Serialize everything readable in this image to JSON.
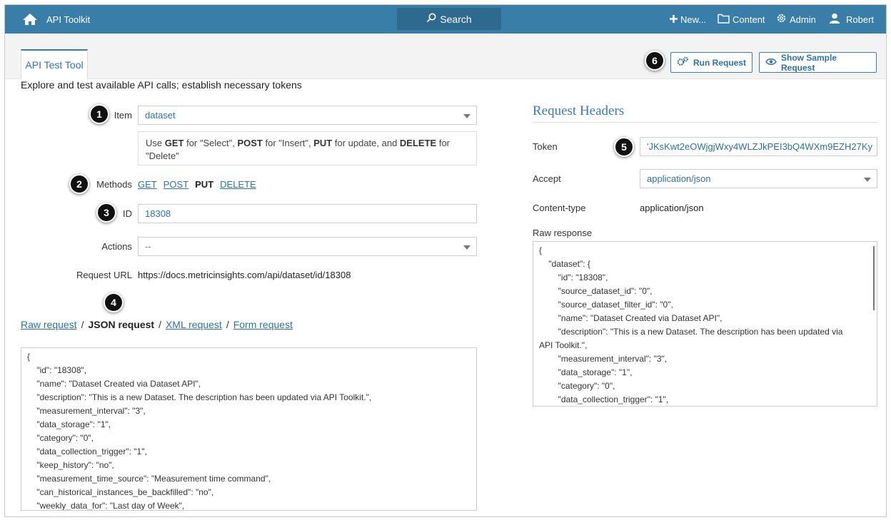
{
  "app": {
    "title": "API Toolkit"
  },
  "topnav": {
    "search_label": "Search",
    "new_label": "New...",
    "content_label": "Content",
    "admin_label": "Admin",
    "user_label": "Robert"
  },
  "tabs": [
    {
      "label": "API Test Tool",
      "active": true
    }
  ],
  "toolbar": {
    "run_label": "Run Request",
    "sample_label": "Show Sample Request"
  },
  "page": {
    "subtitle": "Explore and test available API calls; establish necessary tokens"
  },
  "form": {
    "item_label": "Item",
    "item_value": "dataset",
    "hint": {
      "p1": "Use ",
      "get": "GET",
      "p2": " for \"Select\", ",
      "post": "POST",
      "p3": " for \"Insert\", ",
      "put": "PUT",
      "p4": " for update, and ",
      "delete": "DELETE",
      "p5": " for \"Delete\""
    },
    "methods_label": "Methods",
    "methods": [
      "GET",
      "POST",
      "PUT",
      "DELETE"
    ],
    "selected_method": "PUT",
    "id_label": "ID",
    "id_value": "18308",
    "actions_label": "Actions",
    "actions_value": "--",
    "request_url_label": "Request URL",
    "request_url_value": "https://docs.metricinsights.com/api/dataset/id/18308"
  },
  "request_tabs": {
    "raw": "Raw request",
    "json": "JSON request",
    "xml": "XML request",
    "form": "Form request",
    "separator": "/",
    "active": "JSON request"
  },
  "json_request_lines": [
    "{",
    "    \"id\": \"18308\",",
    "    \"name\": \"Dataset Created via Dataset API\",",
    "    \"description\": \"This is a new Dataset. The description has been updated via API Toolkit.\",",
    "    \"measurement_interval\": \"3\",",
    "    \"data_storage\": \"1\",",
    "    \"category\": \"0\",",
    "    \"data_collection_trigger\": \"1\",",
    "    \"keep_history\": \"no\",",
    "    \"measurement_time_source\": \"Measurement time command\",",
    "    \"can_historical_instances_be_backfilled\": \"no\",",
    "    \"weekly_data_for\": \"Last day of Week\","
  ],
  "headers": {
    "title": "Request Headers",
    "token_label": "Token",
    "token_value": "'JKsKwt2eOWjgjWxy4WLZJkPEI3bQ4WXm9EZH27Ky",
    "accept_label": "Accept",
    "accept_value": "application/json",
    "content_type_label": "Content-type",
    "content_type_value": "application/json",
    "raw_response_label": "Raw response"
  },
  "raw_response_lines": [
    "{",
    "    \"dataset\": {",
    "        \"id\": \"18308\",",
    "        \"source_dataset_id\": \"0\",",
    "        \"source_dataset_filter_id\": \"0\",",
    "        \"name\": \"Dataset Created via Dataset API\",",
    "        \"description\": \"This is a new Dataset. The description has been updated via",
    "API Toolkit.\",",
    "        \"measurement_interval\": \"3\",",
    "        \"data_storage\": \"1\",",
    "        \"category\": \"0\",",
    "        \"data_collection_trigger\": \"1\","
  ],
  "markers": [
    "1",
    "2",
    "3",
    "4",
    "5",
    "6"
  ],
  "colors": {
    "topbar": "#397ea8",
    "accent": "#2d73a0",
    "marker": "#111111"
  }
}
